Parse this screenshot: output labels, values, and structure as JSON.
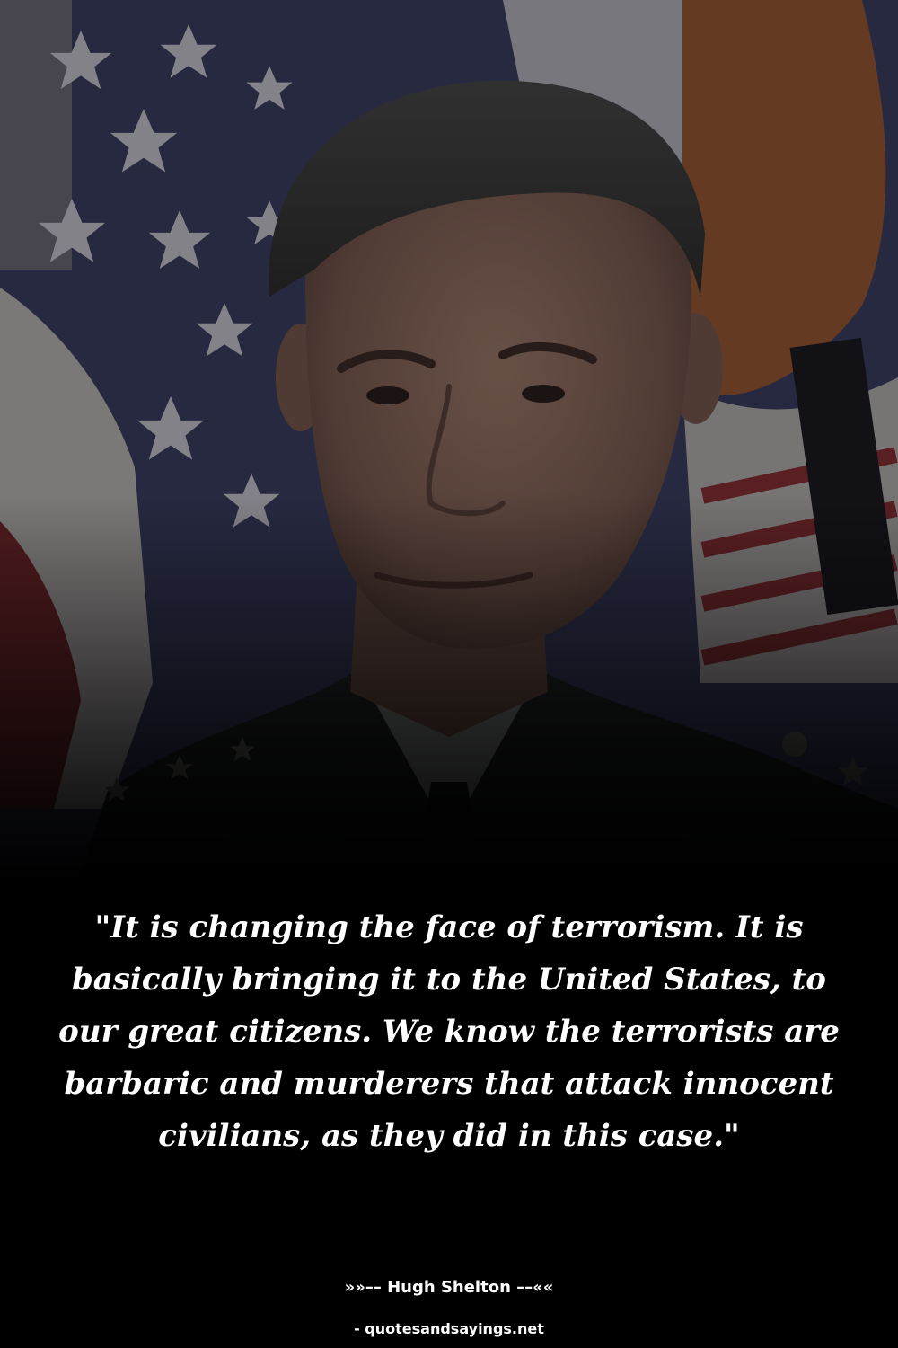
{
  "photo": {
    "subject": "portrait of a uniformed man in front of a flag"
  },
  "quote": {
    "text": "\"It is changing the face of terrorism. It is basically bringing it to the United States, to our great citizens. We know the terrorists are barbaric and murderers that attack innocent civilians, as they did in this case.\""
  },
  "author": {
    "line": "»»–– Hugh Shelton ––««"
  },
  "source": {
    "text": "- quotesandsayings.net"
  },
  "colors": {
    "background": "#000000",
    "text": "#ffffff",
    "flag_blue": "#3b3f63",
    "flag_red": "#7a2a2e",
    "flag_white": "#bdb8b8",
    "skin": "#8a6a5e",
    "uniform": "#1b1d1f"
  }
}
